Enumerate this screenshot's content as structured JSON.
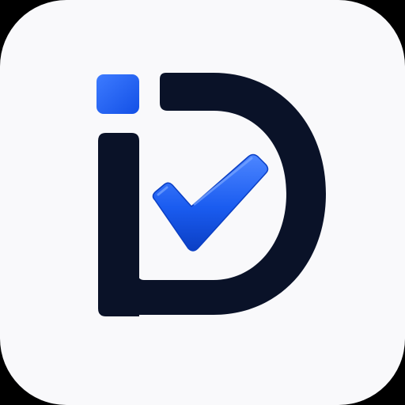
{
  "app_icon": {
    "logo_text": "iD",
    "colors": {
      "tile_background": "#f9f9fb",
      "outer_background": "#000000",
      "letter": "#0a1228",
      "accent": "#1a5cf0",
      "accent_light": "#4d86ff",
      "accent_dark": "#0b3fc4"
    },
    "icon_names": [
      "i-letter-icon",
      "d-letter-icon",
      "checkmark-icon"
    ]
  }
}
